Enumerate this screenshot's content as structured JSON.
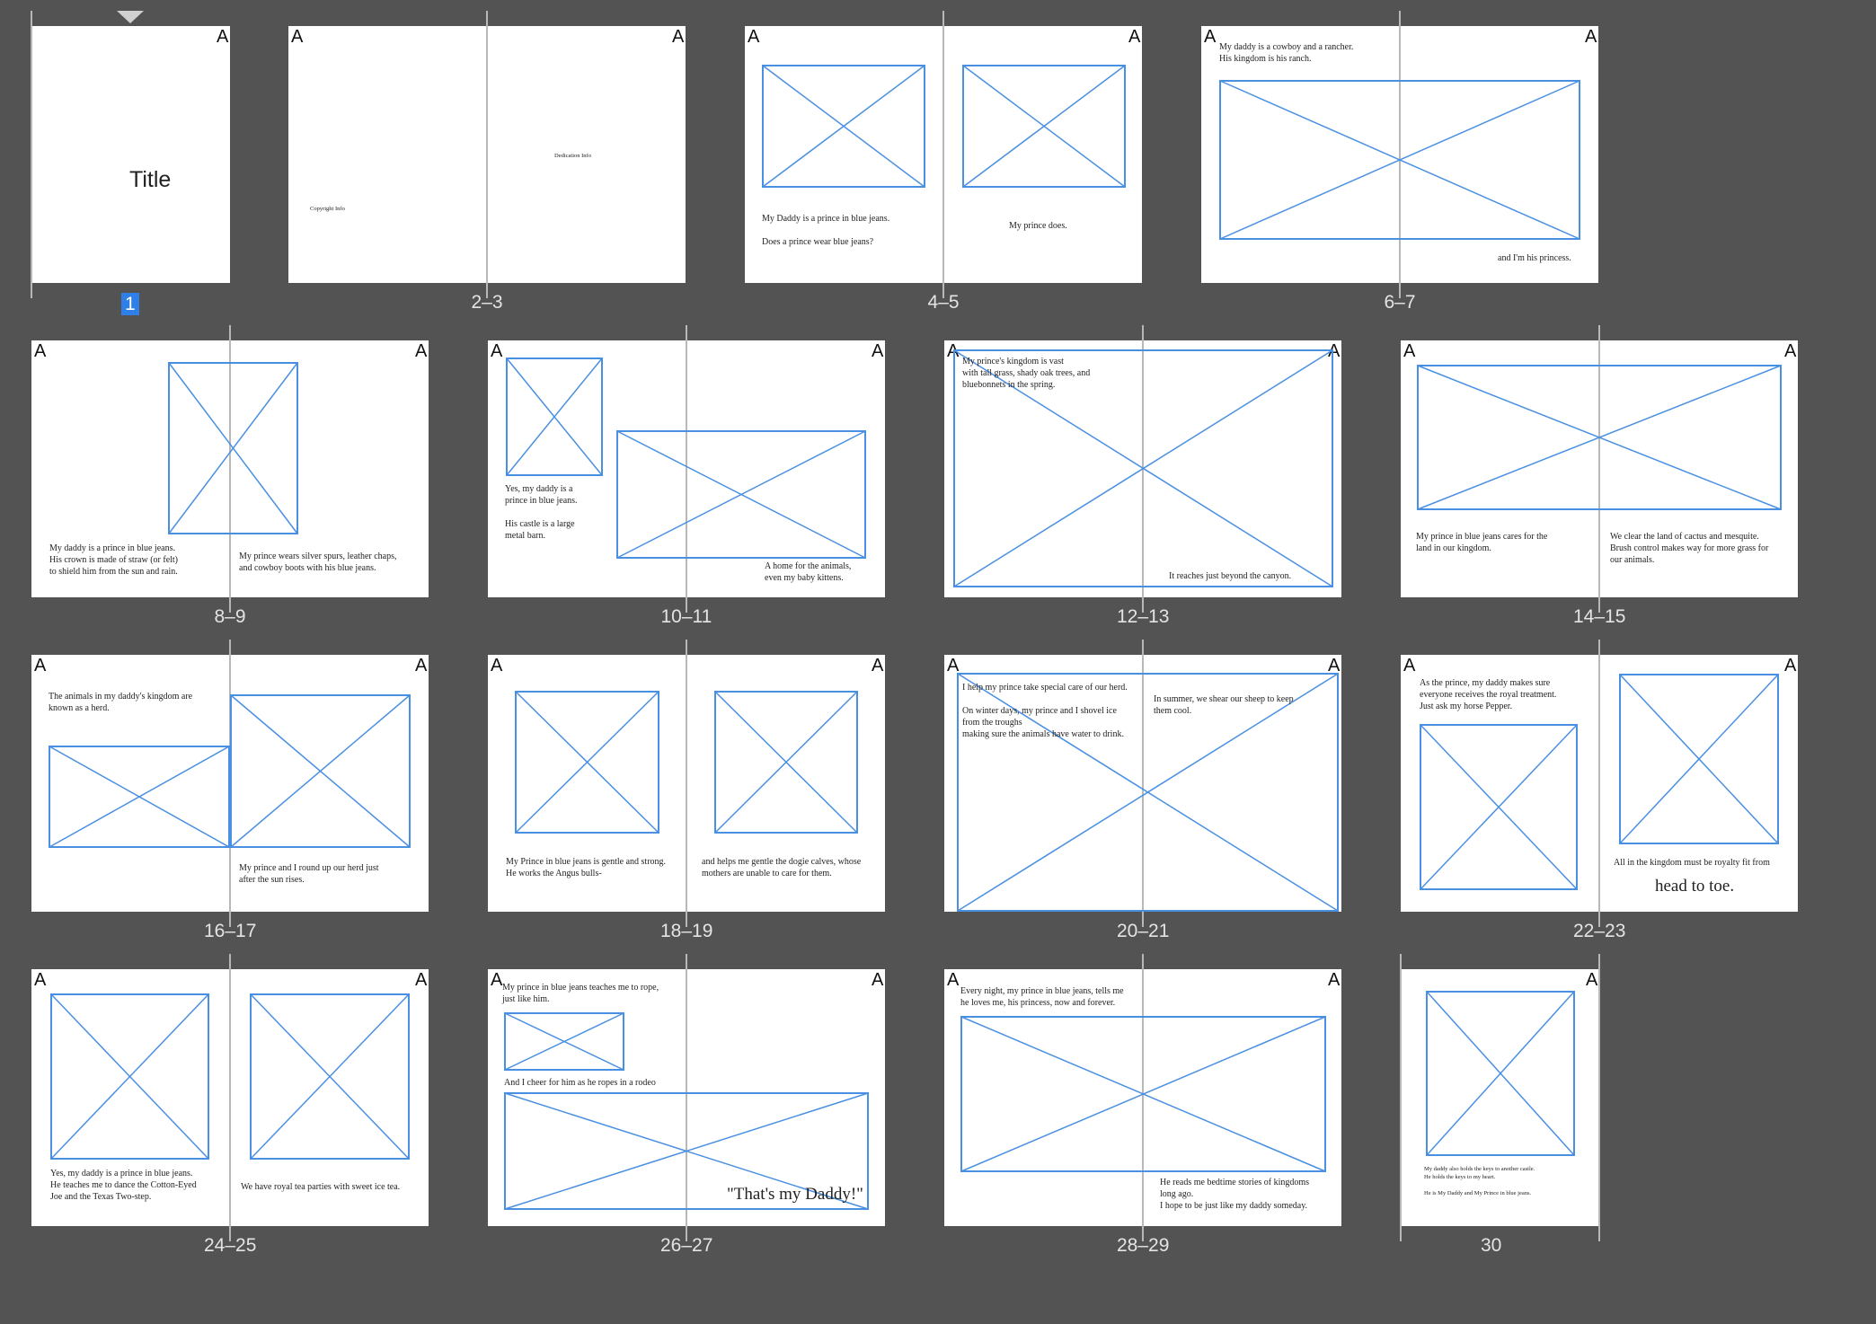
{
  "app": {
    "panel": "Pages",
    "accent_color": "#2f7fe8",
    "frame_color": "#4a90e2"
  },
  "spreads": [
    {
      "label": "1",
      "selected": true,
      "master_labels": [
        "A"
      ],
      "texts": [
        "Title"
      ]
    },
    {
      "label": "2–3",
      "master_labels": [
        "A",
        "A"
      ],
      "texts": [
        "Copyright Info",
        "Dedication Info"
      ]
    },
    {
      "label": "4–5",
      "master_labels": [
        "A",
        "A"
      ],
      "texts": [
        "My Daddy is a prince in blue jeans.\n\nDoes a prince wear blue jeans?",
        "My prince does."
      ]
    },
    {
      "label": "6–7",
      "master_labels": [
        "A",
        "A"
      ],
      "texts": [
        "My daddy is a cowboy and a rancher.\nHis kingdom is his ranch.",
        "and I'm his princess."
      ]
    },
    {
      "label": "8–9",
      "master_labels": [
        "A",
        "A"
      ],
      "texts": [
        "My daddy is a prince in blue jeans.\nHis crown is made of straw (or felt)\nto shield him from the sun and rain.",
        "My prince wears silver spurs, leather chaps,\nand cowboy boots with his blue jeans."
      ]
    },
    {
      "label": "10–11",
      "master_labels": [
        "A",
        "A"
      ],
      "texts": [
        "Yes, my daddy is a\nprince in blue jeans.\n\nHis castle is a large\nmetal barn.",
        "A home for the animals,\neven my baby kittens."
      ]
    },
    {
      "label": "12–13",
      "master_labels": [
        "A",
        "A"
      ],
      "texts": [
        "My prince's kingdom is vast\nwith tall grass, shady oak trees, and\nbluebonnets in the spring.",
        "It reaches just beyond the canyon."
      ]
    },
    {
      "label": "14–15",
      "master_labels": [
        "A",
        "A"
      ],
      "texts": [
        "My prince in blue jeans cares for the\nland in our kingdom.",
        "We clear the land of cactus and mesquite.\nBrush control makes way for more grass for\nour animals."
      ]
    },
    {
      "label": "16–17",
      "master_labels": [
        "A",
        "A"
      ],
      "texts": [
        "The animals in my daddy's kingdom are\nknown as a herd.",
        "My prince and I round up our herd just\nafter the sun rises."
      ]
    },
    {
      "label": "18–19",
      "master_labels": [
        "A",
        "A"
      ],
      "texts": [
        "My Prince in blue jeans is gentle and strong.\nHe works the Angus bulls-",
        "and helps me gentle the dogie calves, whose\nmothers are unable to care for them."
      ]
    },
    {
      "label": "20–21",
      "master_labels": [
        "A",
        "A"
      ],
      "texts": [
        "I help my prince take special care of our herd.\n\nOn winter days, my prince and I shovel ice\nfrom the troughs\nmaking sure the animals have water to drink.",
        "In summer, we shear our sheep to keep\nthem cool."
      ]
    },
    {
      "label": "22–23",
      "master_labels": [
        "A",
        "A"
      ],
      "texts": [
        "As the prince, my daddy makes sure\neveryone receives the royal treatment.\nJust ask my horse Pepper.",
        "All in the kingdom must be royalty fit from",
        "head to toe."
      ]
    },
    {
      "label": "24–25",
      "master_labels": [
        "A",
        "A"
      ],
      "texts": [
        "Yes, my daddy is a prince in blue jeans.\nHe teaches me to dance the Cotton-Eyed\nJoe and the Texas Two-step.",
        "We have royal tea parties with sweet ice tea."
      ]
    },
    {
      "label": "26–27",
      "master_labels": [
        "A",
        "A"
      ],
      "texts": [
        "My prince in blue jeans teaches me to rope,\njust like him.",
        "And I cheer for him as he ropes in a rodeo",
        "\"That's my Daddy!\""
      ]
    },
    {
      "label": "28–29",
      "master_labels": [
        "A",
        "A"
      ],
      "texts": [
        "Every night, my prince in blue jeans, tells me\nhe loves me, his princess, now and forever.",
        "He reads me bedtime stories of kingdoms\nlong ago.\nI hope to be just like my daddy someday."
      ]
    },
    {
      "label": "30",
      "master_labels": [
        "A"
      ],
      "texts": [
        "My daddy also holds the keys to another castle.\nHe holds the keys to my heart.\n\nHe is My Daddy and My Prince in blue jeans."
      ]
    }
  ]
}
